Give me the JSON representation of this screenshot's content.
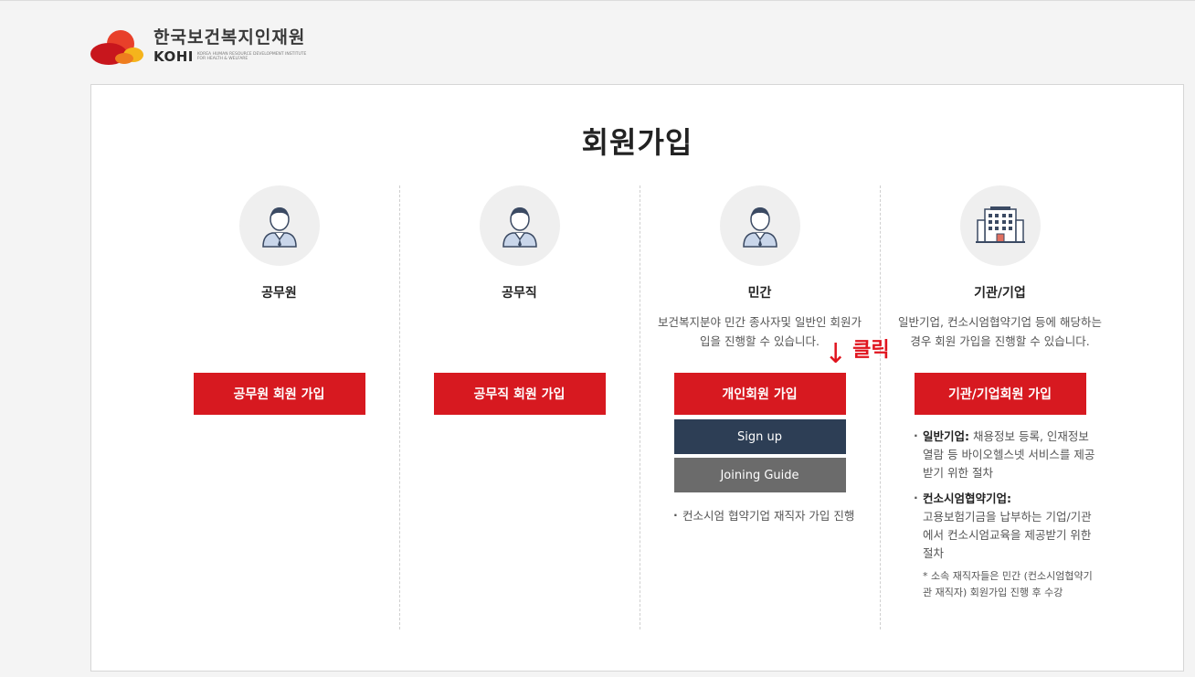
{
  "header": {
    "org_name_kr": "한국보건복지인재원",
    "org_abbr": "KOHI",
    "org_name_en_line1": "KOREA HUMAN RESOURCE DEVELOPMENT INSTITUTE",
    "org_name_en_line2": "FOR HEALTH & WELFARE"
  },
  "page_title": "회원가입",
  "columns": [
    {
      "icon": "person-icon",
      "title": "공무원",
      "description": "",
      "button_label": "공무원 회원 가입"
    },
    {
      "icon": "person-icon",
      "title": "공무직",
      "description": "",
      "button_label": "공무직 회원 가입"
    },
    {
      "icon": "person-icon",
      "title": "민간",
      "description": "보건복지분야 민간 종사자및 일반인 회원가입을 진행할 수 있습니다.",
      "button_label": "개인회원 가입",
      "signup_label": "Sign up",
      "guide_label": "Joining Guide",
      "notes": [
        "컨소시엄 협약기업 재직자 가입 진행"
      ]
    },
    {
      "icon": "building-icon",
      "title": "기관/기업",
      "description": "일반기업, 컨소시엄협약기업 등에 해당하는 경우 회원 가입을 진행할 수 있습니다.",
      "button_label": "기관/기업회원 가입",
      "notes": [
        {
          "term": "일반기업:",
          "text": "채용정보 등록, 인재정보 열람 등 바이오헬스넷 서비스를 제공받기 위한 절차"
        },
        {
          "term": "컨소시엄협약기업:",
          "text": "고용보험기금을 납부하는 기업/기관에서 컨소시엄교육을 제공받기 위한 절차"
        }
      ],
      "footnote": "* 소속 재직자들은 민간 (컨소시엄협약기관 재직자) 회원가입 진행 후 수강"
    }
  ],
  "annotation": {
    "arrow": "↓",
    "label": "클릭"
  },
  "colors": {
    "primary_red": "#d71920",
    "navy": "#2d3e55",
    "gray_button": "#6b6b6b",
    "annotation_red": "#e0141e"
  }
}
